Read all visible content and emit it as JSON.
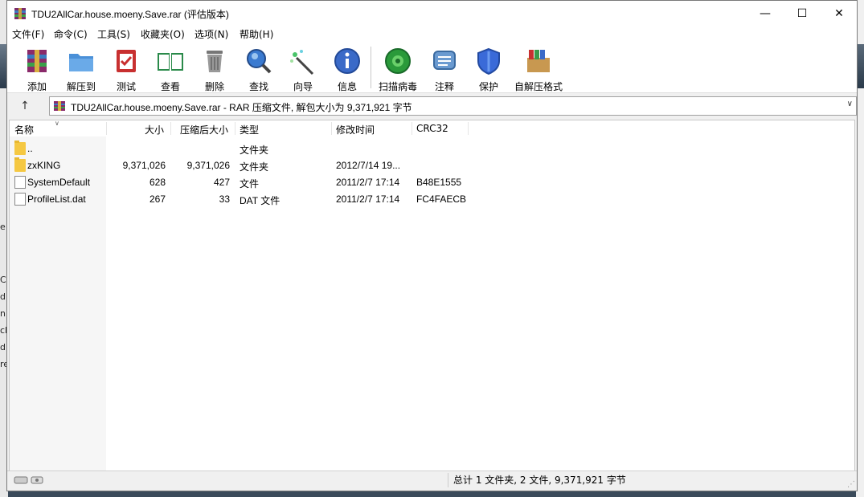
{
  "window": {
    "title": "TDU2AllCar.house.moeny.Save.rar (评估版本)",
    "controls": {
      "minimize": "—",
      "maximize": "☐",
      "close": "✕"
    }
  },
  "menu": [
    "文件(F)",
    "命令(C)",
    "工具(S)",
    "收藏夹(O)",
    "选项(N)",
    "帮助(H)"
  ],
  "toolbar": [
    {
      "label": "添加",
      "icon": "add-archive-icon"
    },
    {
      "label": "解压到",
      "icon": "extract-folder-icon"
    },
    {
      "label": "测试",
      "icon": "test-clipboard-icon"
    },
    {
      "label": "查看",
      "icon": "view-book-icon"
    },
    {
      "label": "删除",
      "icon": "trash-icon"
    },
    {
      "label": "查找",
      "icon": "magnifier-icon"
    },
    {
      "label": "向导",
      "icon": "wizard-wand-icon"
    },
    {
      "label": "信息",
      "icon": "info-icon"
    },
    {
      "label": "扫描病毒",
      "icon": "virus-scan-icon"
    },
    {
      "label": "注释",
      "icon": "comment-icon"
    },
    {
      "label": "保护",
      "icon": "shield-icon"
    },
    {
      "label": "自解压格式",
      "icon": "sfx-box-icon"
    }
  ],
  "address": {
    "up_arrow": "↑",
    "text": "TDU2AllCar.house.moeny.Save.rar - RAR 压缩文件, 解包大小为 9,371,921 字节",
    "dropdown": "∨"
  },
  "columns": {
    "name": "名称",
    "size": "大小",
    "packed": "压缩后大小",
    "type": "类型",
    "modified": "修改时间",
    "crc": "CRC32"
  },
  "files": [
    {
      "name": "..",
      "size": "",
      "packed": "",
      "type": "文件夹",
      "modified": "",
      "crc": "",
      "kind": "folder"
    },
    {
      "name": "zxKING",
      "size": "9,371,026",
      "packed": "9,371,026",
      "type": "文件夹",
      "modified": "2012/7/14 19...",
      "crc": "",
      "kind": "folder"
    },
    {
      "name": "SystemDefault",
      "size": "628",
      "packed": "427",
      "type": "文件",
      "modified": "2011/2/7 17:14",
      "crc": "B48E1555",
      "kind": "file"
    },
    {
      "name": "ProfileList.dat",
      "size": "267",
      "packed": "33",
      "type": "DAT 文件",
      "modified": "2011/2/7 17:14",
      "crc": "FC4FAECB",
      "kind": "file"
    }
  ],
  "status": {
    "summary": "总计 1 文件夹, 2 文件, 9,371,921 字节"
  },
  "desktop_fragments": [
    "e",
    "C",
    "dp",
    "n",
    "cl",
    "d",
    "re"
  ]
}
